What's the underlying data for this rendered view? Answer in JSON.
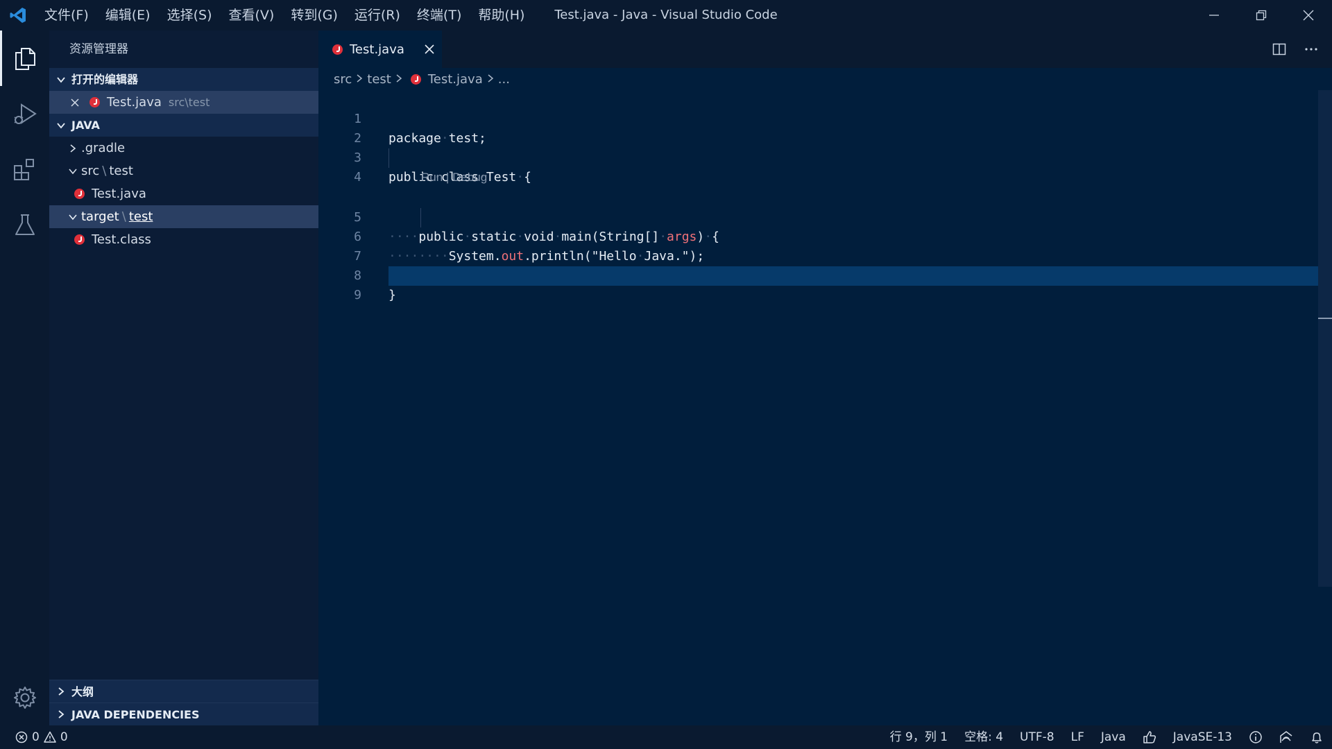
{
  "window": {
    "title": "Test.java - Java - Visual Studio Code"
  },
  "menu": [
    "文件(F)",
    "编辑(E)",
    "选择(S)",
    "查看(V)",
    "转到(G)",
    "运行(R)",
    "终端(T)",
    "帮助(H)"
  ],
  "sidebar": {
    "title": "资源管理器",
    "open_editors": {
      "header": "打开的编辑器",
      "items": [
        {
          "name": "Test.java",
          "path": "src\\test"
        }
      ]
    },
    "workspace": {
      "header": "JAVA",
      "items": [
        {
          "label": ".gradle"
        },
        {
          "label_a": "src",
          "label_b": "test"
        },
        {
          "label": "Test.java"
        },
        {
          "label_a": "target",
          "label_b": "test"
        },
        {
          "label": "Test.class"
        }
      ]
    },
    "outline": "大纲",
    "java_dependencies": "JAVA DEPENDENCIES"
  },
  "tabs": [
    {
      "label": "Test.java"
    }
  ],
  "breadcrumb": [
    "src",
    "test",
    "Test.java",
    "..."
  ],
  "editor": {
    "codelens": {
      "run": "Run",
      "separator": "|",
      "debug": "Debug"
    },
    "line_numbers": [
      "1",
      "2",
      "3",
      "4",
      "5",
      "6",
      "7",
      "8",
      "9"
    ]
  },
  "statusbar": {
    "errors": "0",
    "warnings": "0",
    "position": "行 9，列 1",
    "spaces": "空格: 4",
    "encoding": "UTF-8",
    "eol": "LF",
    "language": "Java",
    "java_version": "JavaSE-13"
  },
  "colors": {
    "editor_bg": "#011e3c",
    "sidebar_bg": "#0b1c36",
    "accent_red": "#e0303a"
  }
}
